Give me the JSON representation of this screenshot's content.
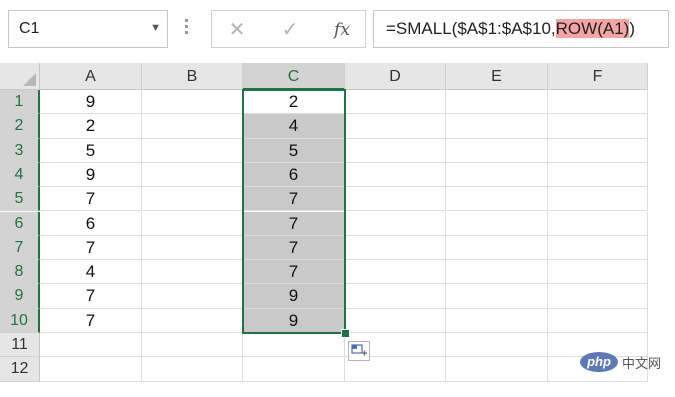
{
  "formula_bar": {
    "name_box": "C1",
    "cancel_glyph": "✕",
    "enter_glyph": "✓",
    "fx_label": "fx",
    "formula_prefix": "=SMALL($A$1:$A$10,",
    "formula_highlight": "ROW(A1)",
    "formula_suffix": ")"
  },
  "columns": [
    "A",
    "B",
    "C",
    "D",
    "E",
    "F"
  ],
  "rows": [
    "1",
    "2",
    "3",
    "4",
    "5",
    "6",
    "7",
    "8",
    "9",
    "10",
    "11",
    "12"
  ],
  "column_a": [
    "9",
    "2",
    "5",
    "9",
    "7",
    "6",
    "7",
    "4",
    "7",
    "7"
  ],
  "column_c": [
    "2",
    "4",
    "5",
    "6",
    "7",
    "7",
    "7",
    "7",
    "9",
    "9"
  ],
  "selection": {
    "column": "C",
    "from_row": 1,
    "to_row": 10
  },
  "colors": {
    "selection_green": "#217346",
    "formula_highlight": "#f4a4a4",
    "selected_fill": "#c9c9c9"
  },
  "watermark": {
    "badge": "php",
    "text": "中文网"
  }
}
